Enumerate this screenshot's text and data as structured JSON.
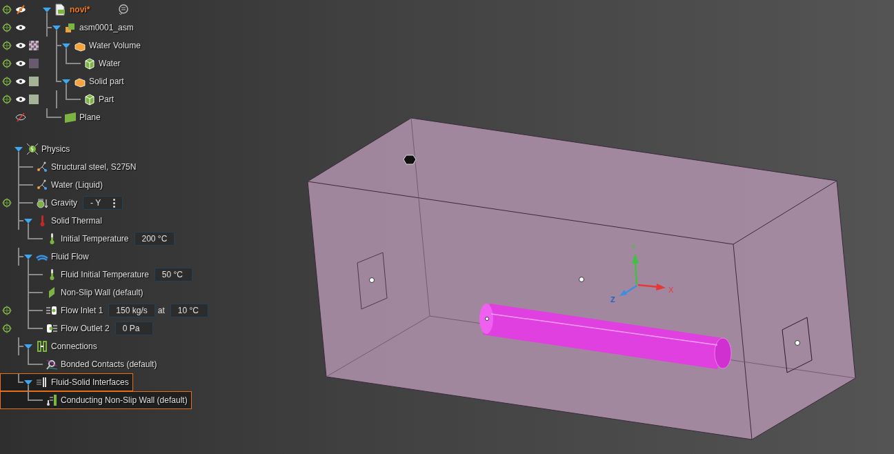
{
  "model_tree": {
    "nodes": [
      {
        "label": "novi*",
        "kind": "document",
        "expanded": true,
        "modified": true,
        "locate": true,
        "visible": true,
        "partial": true,
        "children": [
          {
            "label": "asm0001_asm",
            "kind": "assembly",
            "expanded": true,
            "locate": true,
            "visible": true,
            "children": [
              {
                "label": "Water Volume",
                "kind": "body",
                "expanded": true,
                "locate": true,
                "visible": true,
                "swatch": {
                  "kind": "checker",
                  "color": "#c9b6c6"
                },
                "children": [
                  {
                    "label": "Water",
                    "kind": "cube",
                    "locate": true,
                    "visible": true,
                    "swatch": {
                      "kind": "solid",
                      "color": "#6a5a70"
                    }
                  }
                ]
              },
              {
                "label": "Solid part",
                "kind": "body",
                "expanded": true,
                "locate": true,
                "visible": true,
                "swatch": {
                  "kind": "solid",
                  "color": "#a5b396"
                },
                "children": [
                  {
                    "label": "Part",
                    "kind": "cube",
                    "locate": true,
                    "visible": true,
                    "swatch": {
                      "kind": "solid",
                      "color": "#a5b396"
                    }
                  }
                ]
              }
            ]
          },
          {
            "label": "Plane",
            "kind": "plane",
            "locate": false,
            "visible": false
          }
        ]
      }
    ]
  },
  "physics_tree": {
    "nodes": [
      {
        "label": "Physics",
        "kind": "physics",
        "expanded": true,
        "children": [
          {
            "label": "Structural steel, S275N",
            "kind": "material"
          },
          {
            "label": "Water (Liquid)",
            "kind": "material"
          },
          {
            "label": "Gravity",
            "kind": "gravity",
            "locate": true,
            "fields": [
              {
                "kind": "dropdown",
                "text": "- Y"
              }
            ]
          },
          {
            "label": "Solid Thermal",
            "kind": "thermometer-red",
            "expanded": true,
            "children": [
              {
                "label": "Initial Temperature",
                "kind": "thermometer-green",
                "fields": [
                  {
                    "kind": "value",
                    "text": "200 °C"
                  }
                ]
              }
            ]
          },
          {
            "label": "Fluid Flow",
            "kind": "flow",
            "expanded": true,
            "children": [
              {
                "label": "Fluid Initial Temperature",
                "kind": "thermometer-green",
                "fields": [
                  {
                    "kind": "value",
                    "text": "50 °C"
                  }
                ]
              },
              {
                "label": "Non-Slip Wall (default)",
                "kind": "wall"
              },
              {
                "label": "Flow Inlet 1",
                "kind": "inlet",
                "locate": true,
                "fields": [
                  {
                    "kind": "value",
                    "text": "150 kg/s"
                  },
                  {
                    "kind": "text",
                    "text": "at"
                  },
                  {
                    "kind": "value",
                    "text": "10 °C"
                  }
                ]
              },
              {
                "label": "Flow Outlet 2",
                "kind": "outlet",
                "locate": true,
                "fields": [
                  {
                    "kind": "value",
                    "text": "0 Pa"
                  }
                ]
              }
            ]
          },
          {
            "label": "Connections",
            "kind": "connections",
            "expanded": true,
            "children": [
              {
                "label": "Bonded Contacts (default)",
                "kind": "contact"
              }
            ]
          },
          {
            "label": "Fluid-Solid Interfaces",
            "kind": "interface",
            "expanded": true,
            "selected": true,
            "children": [
              {
                "label": "Conducting Non-Slip Wall (default)",
                "kind": "conducting-wall",
                "selected": true
              }
            ]
          }
        ]
      }
    ]
  },
  "viewport": {
    "axes": {
      "x": "X",
      "y": "Y",
      "z": "Z"
    }
  }
}
